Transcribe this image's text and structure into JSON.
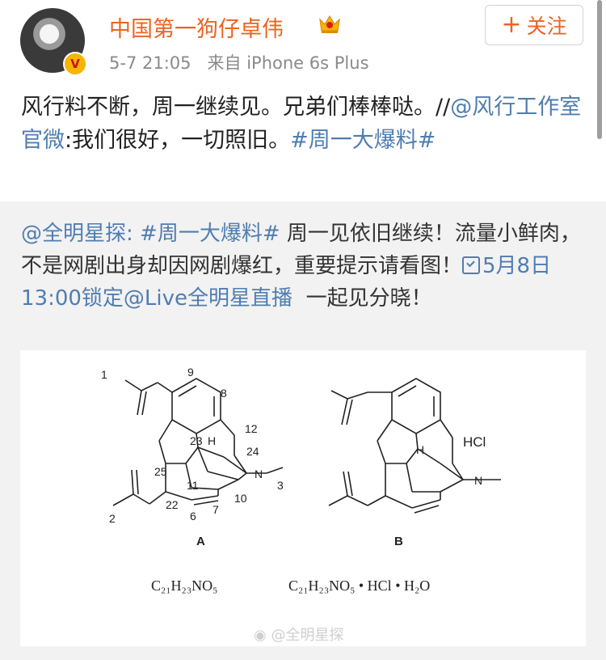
{
  "author": {
    "name": "中国第一狗仔卓伟",
    "badge_letter": "V",
    "time": "5-7 21:05",
    "source_prefix": "来自",
    "device": "iPhone 6s Plus",
    "follow_label": "关注",
    "follow_icon": "+"
  },
  "post": {
    "text_part1": "风行料不断，周一继续见。兄弟们棒棒哒。//",
    "mention": "@风行工作室官微",
    "text_part2": ":我们很好，一切照旧。",
    "hashtag": "#周一大爆料#"
  },
  "retweet": {
    "mention": "@全明星探",
    "colon": ":",
    "hashtag": "#周一大爆料#",
    "text_part1": "周一见依旧继续！流量小鲜肉，不是网剧出身却因网剧爆红，重要提示请看图！",
    "event_link": "5月8日13:00锁定@Live全明星直播",
    "text_part2": "一起见分晓！"
  },
  "figure": {
    "caption_a": "A",
    "caption_b": "B",
    "formula_a": "C₂₁H₂₃NO₅",
    "formula_b": "C₂₁H₂₃NO₅ • HCl • H₂O",
    "hcl": "HCl",
    "labels": [
      "1",
      "9",
      "8",
      "12",
      "23",
      "H",
      "24",
      "N",
      "3",
      "25",
      "11",
      "10",
      "7",
      "6",
      "22",
      "2"
    ],
    "watermark": "@全明星探"
  },
  "colors": {
    "name": "#ec6322",
    "link": "#4f7db1",
    "vip_gold": "#f7b500"
  }
}
